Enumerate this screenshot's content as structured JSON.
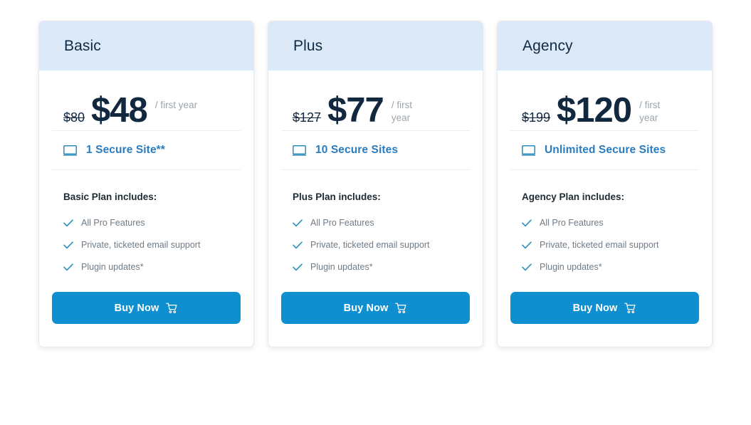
{
  "colors": {
    "page_background": "#ffffff",
    "card_header_background": "#dce9f8",
    "accent_blue": "#108fd0",
    "sites_label_blue": "#2a7cc0",
    "price_dark": "#12283f",
    "feature_text_gray": "#6f7b85",
    "period_gray": "#9aa5ad",
    "check_teal": "#2a8fbd"
  },
  "plans": [
    {
      "name": "Basic",
      "price_old": "$80",
      "price_new": "$48",
      "price_period": "/ first year",
      "sites_icon": "monitor-icon",
      "sites_label": "1 Secure Site**",
      "includes_title": "Basic Plan includes:",
      "features": [
        "All Pro Features",
        "Private, ticketed email support",
        "Plugin updates*"
      ],
      "buy_label": "Buy Now",
      "buy_icon": "shopping-cart-icon"
    },
    {
      "name": "Plus",
      "price_old": "$127",
      "price_new": "$77",
      "price_period": "/ first year",
      "sites_icon": "monitor-icon",
      "sites_label": "10 Secure Sites",
      "includes_title": "Plus Plan includes:",
      "features": [
        "All Pro Features",
        "Private, ticketed email support",
        "Plugin updates*"
      ],
      "buy_label": "Buy Now",
      "buy_icon": "shopping-cart-icon"
    },
    {
      "name": "Agency",
      "price_old": "$199",
      "price_new": "$120",
      "price_period": "/ first year",
      "sites_icon": "monitor-icon",
      "sites_label": "Unlimited Secure Sites",
      "includes_title": "Agency Plan includes:",
      "features": [
        "All Pro Features",
        "Private, ticketed email support",
        "Plugin updates*"
      ],
      "buy_label": "Buy Now",
      "buy_icon": "shopping-cart-icon"
    }
  ]
}
